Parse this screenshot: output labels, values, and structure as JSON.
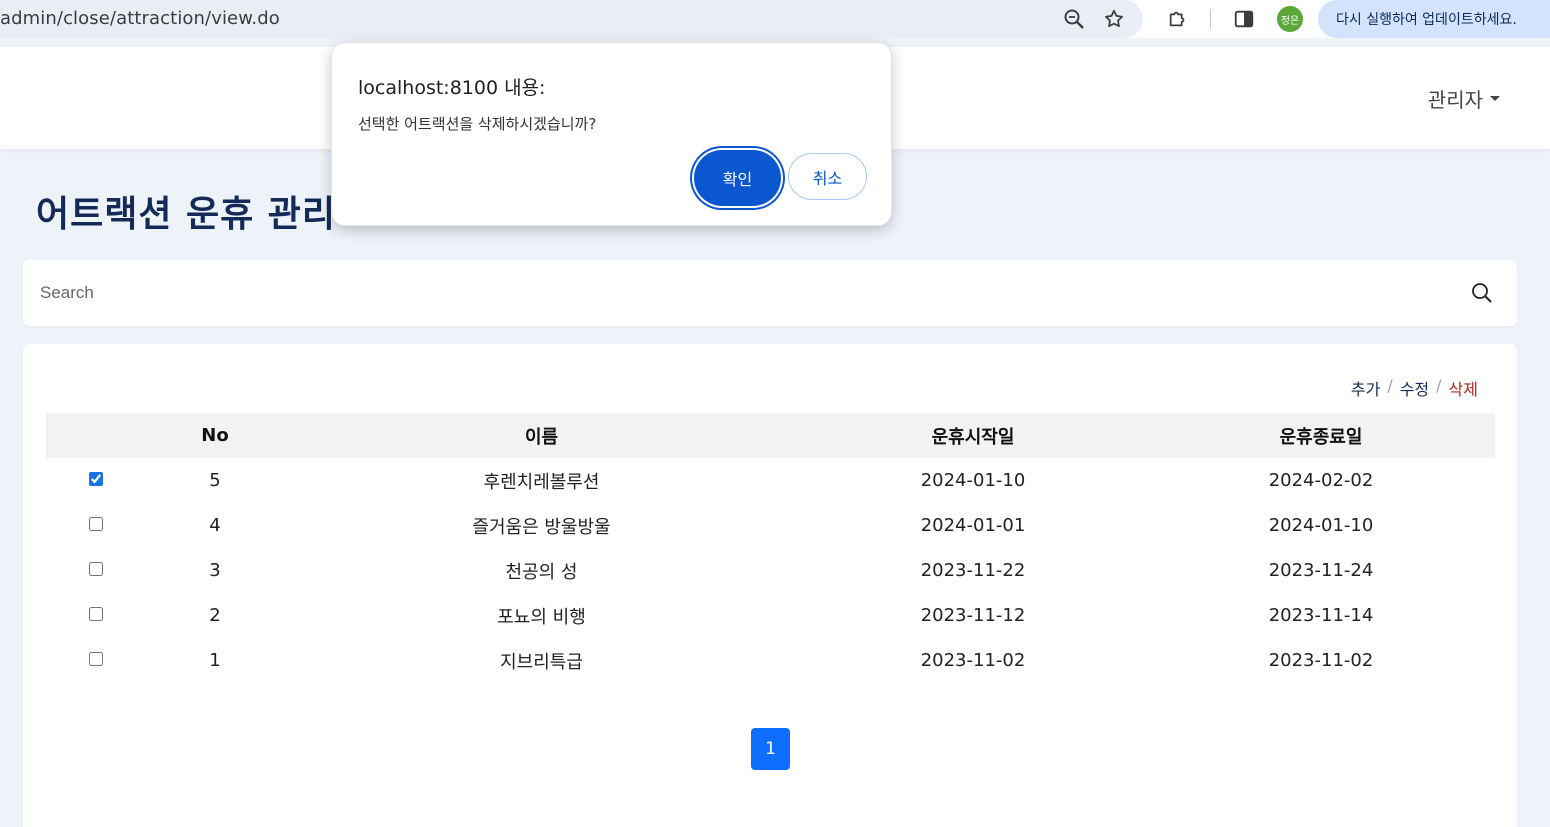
{
  "browser": {
    "url": "admin/close/attraction/view.do",
    "profile_initials": "정은",
    "update_label": "다시 실행하여 업데이트하세요."
  },
  "header": {
    "admin_menu_label": "관리자"
  },
  "page": {
    "title": "어트랙션 운휴 관리"
  },
  "search": {
    "placeholder": "Search"
  },
  "actions": {
    "add_label": "추가",
    "edit_label": "수정",
    "delete_label": "삭제",
    "separator": "/"
  },
  "table": {
    "columns": [
      "No",
      "이름",
      "운휴시작일",
      "운휴종료일"
    ],
    "rows": [
      {
        "checked": true,
        "no": "5",
        "name": "후렌치레볼루션",
        "start": "2024-01-10",
        "end": "2024-02-02"
      },
      {
        "checked": false,
        "no": "4",
        "name": "즐거움은 방울방울",
        "start": "2024-01-01",
        "end": "2024-01-10"
      },
      {
        "checked": false,
        "no": "3",
        "name": "천공의 성",
        "start": "2023-11-22",
        "end": "2023-11-24"
      },
      {
        "checked": false,
        "no": "2",
        "name": "포뇨의 비행",
        "start": "2023-11-12",
        "end": "2023-11-14"
      },
      {
        "checked": false,
        "no": "1",
        "name": "지브리특급",
        "start": "2023-11-02",
        "end": "2023-11-02"
      }
    ]
  },
  "pagination": {
    "current_page": "1"
  },
  "dialog": {
    "title": "localhost:8100 내용:",
    "message": "선택한 어트랙션을 삭제하시겠습니까?",
    "ok_label": "확인",
    "cancel_label": "취소"
  },
  "colors": {
    "title": "#142a57",
    "primary": "#0b57d0",
    "pager": "#0d6efd",
    "danger": "#b3261e"
  },
  "icons": [
    "zoom-icon",
    "star-icon",
    "extensions-icon",
    "side-panel-icon",
    "search-icon",
    "caret-down-icon"
  ]
}
